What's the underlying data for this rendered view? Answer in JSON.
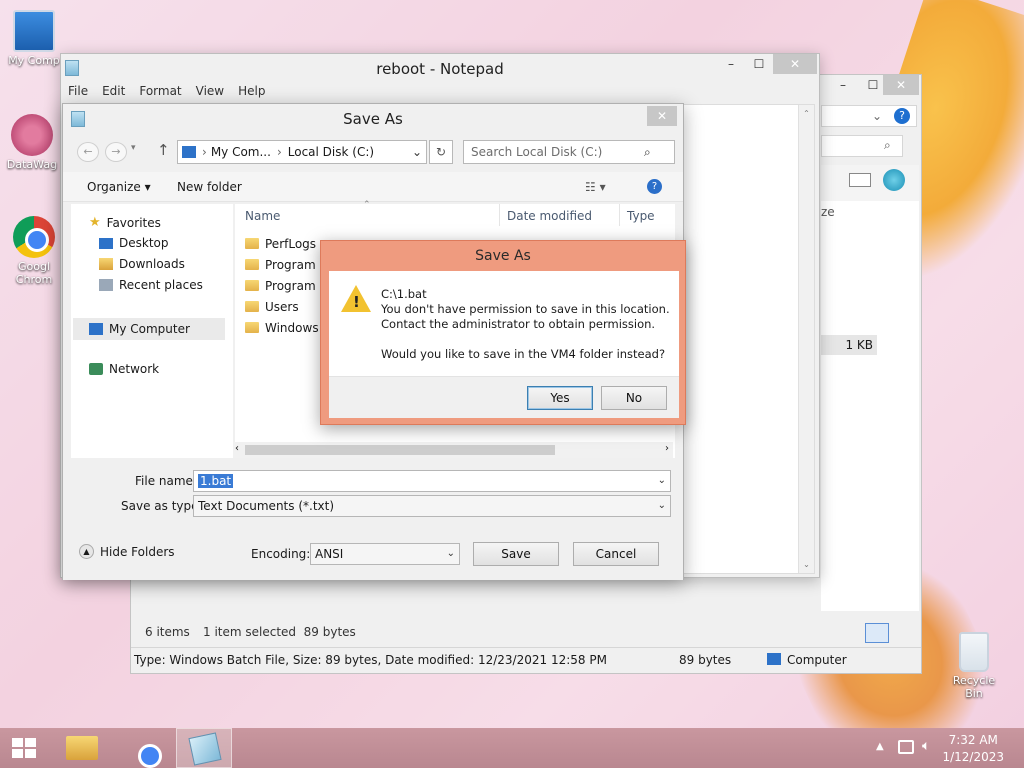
{
  "desktop": {
    "icons": [
      {
        "label": "My Comp"
      },
      {
        "label": "DataWag"
      },
      {
        "label": "Googl Chrom"
      },
      {
        "label": "Recycle Bin"
      }
    ]
  },
  "notepad": {
    "title": "reboot - Notepad",
    "menu": [
      "File",
      "Edit",
      "Format",
      "View",
      "Help"
    ]
  },
  "explorer": {
    "partial_header": "ze",
    "size_cell": "1 KB",
    "items_count": "6 items",
    "selected": "1 item selected  89 bytes",
    "statusbar": "Type: Windows Batch File, Size: 89 bytes, Date modified: 12/23/2021 12:58 PM",
    "status_size": "89 bytes",
    "status_location": "Computer"
  },
  "saveas": {
    "title": "Save As",
    "breadcrumb": [
      "My Com...",
      "Local Disk (C:)"
    ],
    "search_placeholder": "Search Local Disk (C:)",
    "organize": "Organize ▾",
    "new_folder": "New folder",
    "nav": {
      "favorites": "Favorites",
      "desktop": "Desktop",
      "downloads": "Downloads",
      "recent": "Recent places",
      "my_computer": "My Computer",
      "network": "Network"
    },
    "columns": {
      "name": "Name",
      "date": "Date modified",
      "type": "Type"
    },
    "files": [
      "PerfLogs",
      "Program F",
      "Program F",
      "Users",
      "Windows"
    ],
    "file_name_label": "File name:",
    "file_name_value": "1.bat",
    "save_type_label": "Save as type:",
    "save_type_value": "Text Documents (*.txt)",
    "hide_folders": "Hide Folders",
    "encoding_label": "Encoding:",
    "encoding_value": "ANSI",
    "save_btn": "Save",
    "cancel_btn": "Cancel"
  },
  "alert": {
    "title": "Save As",
    "path": "C:\\1.bat",
    "line1": "You don't have permission to save in this location.",
    "line2": "Contact the administrator to obtain permission.",
    "question": "Would you like to save in the VM4 folder instead?",
    "yes": "Yes",
    "no": "No"
  },
  "taskbar": {
    "time": "7:32 AM",
    "date": "1/12/2023"
  }
}
